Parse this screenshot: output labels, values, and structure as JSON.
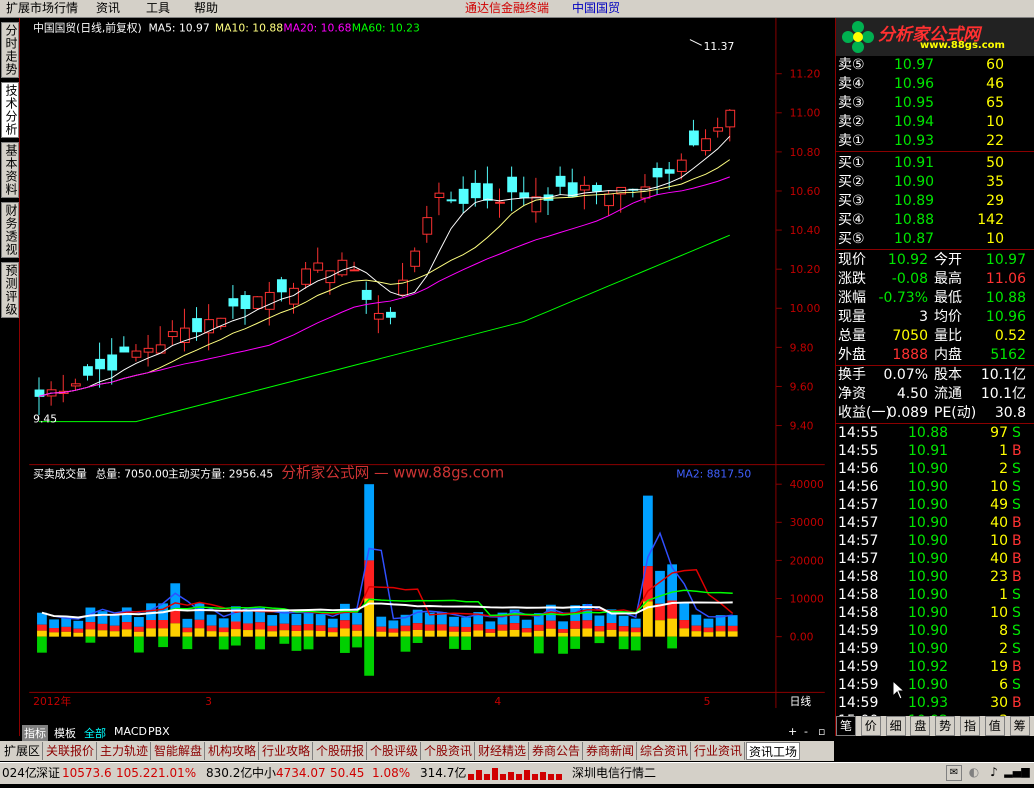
{
  "menubar": {
    "items": [
      "扩展市场行情",
      "资讯",
      "工具",
      "帮助"
    ],
    "brand": "通达信金融终端",
    "stock": "中国国贸"
  },
  "watermark": {
    "logo": "分析家公式网",
    "url": "www.88gs.com",
    "overlay": "分析家公式网 — www.88gs.com"
  },
  "left_tabs": [
    "分时走势",
    "技术分析",
    "基本资料",
    "财务透视",
    "预测评级"
  ],
  "kline": {
    "header": "中国国贸(日线,前复权)",
    "ma5": "MA5: 10.97",
    "ma10": "MA10: 10.88",
    "ma20": "MA20: 10.68",
    "ma60": "MA60: 10.23",
    "ticks": [
      "11.20",
      "11.00",
      "10.80",
      "10.60",
      "10.40",
      "10.20",
      "10.00",
      "9.80",
      "9.60",
      "9.40"
    ],
    "high_label": "11.37",
    "low_label": "9.45"
  },
  "volume": {
    "header": "买卖成交量",
    "total": "总量: 7050.00",
    "active_buy": "主动买方量: 2956.45",
    "ma2": "MA2: 8817.50",
    "ticks": [
      "40000",
      "30000",
      "20000",
      "10000",
      "0.00"
    ]
  },
  "x_axis": {
    "labels": [
      "2012年",
      "3",
      "4",
      "5"
    ],
    "period": "日线"
  },
  "indicator_tabs": [
    "指标",
    "模板",
    "全部",
    "MACD",
    "PBX"
  ],
  "bottom_tabs": [
    "扩展区",
    "关联报价",
    "主力轨迹",
    "智能解盘",
    "机构攻略",
    "行业攻略",
    "个股研报",
    "个股评级",
    "个股资讯",
    "财经精选",
    "券商公告",
    "券商新闻",
    "综合资讯",
    "行业资讯",
    "资讯工场"
  ],
  "right_tabs": [
    "笔",
    "价",
    "细",
    "盘",
    "势",
    "指",
    "值",
    "筹"
  ],
  "orderbook": {
    "sell": [
      {
        "label": "卖⑤",
        "price": "10.97",
        "vol": "60"
      },
      {
        "label": "卖④",
        "price": "10.96",
        "vol": "46"
      },
      {
        "label": "卖③",
        "price": "10.95",
        "vol": "65"
      },
      {
        "label": "卖②",
        "price": "10.94",
        "vol": "10"
      },
      {
        "label": "卖①",
        "price": "10.93",
        "vol": "22"
      }
    ],
    "buy": [
      {
        "label": "买①",
        "price": "10.91",
        "vol": "50"
      },
      {
        "label": "买②",
        "price": "10.90",
        "vol": "35"
      },
      {
        "label": "买③",
        "price": "10.89",
        "vol": "29"
      },
      {
        "label": "买④",
        "price": "10.88",
        "vol": "142"
      },
      {
        "label": "买⑤",
        "price": "10.87",
        "vol": "10"
      }
    ]
  },
  "quote": [
    {
      "l1": "现价",
      "v1": "10.92",
      "l2": "今开",
      "v2": "10.97",
      "c1": "green",
      "c2": "green"
    },
    {
      "l1": "涨跌",
      "v1": "-0.08",
      "l2": "最高",
      "v2": "11.06",
      "c1": "green",
      "c2": "red"
    },
    {
      "l1": "涨幅",
      "v1": "-0.73%",
      "l2": "最低",
      "v2": "10.88",
      "c1": "green",
      "c2": "green"
    },
    {
      "l1": "现量",
      "v1": "3",
      "l2": "均价",
      "v2": "10.96",
      "c1": "white",
      "c2": "green"
    },
    {
      "l1": "总量",
      "v1": "7050",
      "l2": "量比",
      "v2": "0.52",
      "c1": "yellow",
      "c2": "yellow"
    },
    {
      "l1": "外盘",
      "v1": "1888",
      "l2": "内盘",
      "v2": "5162",
      "c1": "red",
      "c2": "green"
    }
  ],
  "quote2": [
    {
      "l1": "换手",
      "v1": "0.07%",
      "l2": "股本",
      "v2": "10.1亿"
    },
    {
      "l1": "净资",
      "v1": "4.50",
      "l2": "流通",
      "v2": "10.1亿"
    },
    {
      "l1": "收益(一)",
      "v1": "0.089",
      "l2": "PE(动)",
      "v2": "30.8"
    }
  ],
  "ticks": [
    {
      "t": "14:55",
      "p": "10.88",
      "v": "97",
      "s": "S"
    },
    {
      "t": "14:55",
      "p": "10.91",
      "v": "1",
      "s": "B"
    },
    {
      "t": "14:56",
      "p": "10.90",
      "v": "2",
      "s": "S"
    },
    {
      "t": "14:56",
      "p": "10.90",
      "v": "10",
      "s": "S"
    },
    {
      "t": "14:57",
      "p": "10.90",
      "v": "49",
      "s": "S"
    },
    {
      "t": "14:57",
      "p": "10.90",
      "v": "40",
      "s": "B"
    },
    {
      "t": "14:57",
      "p": "10.90",
      "v": "10",
      "s": "B"
    },
    {
      "t": "14:57",
      "p": "10.90",
      "v": "40",
      "s": "B"
    },
    {
      "t": "14:58",
      "p": "10.90",
      "v": "23",
      "s": "B"
    },
    {
      "t": "14:58",
      "p": "10.90",
      "v": "1",
      "s": "S"
    },
    {
      "t": "14:58",
      "p": "10.90",
      "v": "10",
      "s": "S"
    },
    {
      "t": "14:59",
      "p": "10.90",
      "v": "8",
      "s": "S"
    },
    {
      "t": "14:59",
      "p": "10.90",
      "v": "2",
      "s": "S"
    },
    {
      "t": "14:59",
      "p": "10.92",
      "v": "19",
      "s": "B"
    },
    {
      "t": "14:59",
      "p": "10.90",
      "v": "6",
      "s": "S"
    },
    {
      "t": "14:59",
      "p": "10.93",
      "v": "30",
      "s": "B"
    },
    {
      "t": "15:00",
      "p": "10.92",
      "v": "3",
      "s": ""
    }
  ],
  "statusbar": {
    "seg0": "024亿",
    "sz_name": "深证",
    "sz_val": "10573.6",
    "sz_chg": "105.22",
    "sz_pct": "1.01%",
    "sz_amt": "830.2亿",
    "zx_name": "中小",
    "zx_val": "4734.07",
    "zx_chg": "50.45",
    "zx_pct": "1.08%",
    "zx_amt": "314.7亿",
    "server": "深圳电信行情二"
  },
  "colors": {
    "up": "#ff3232",
    "down": "#00ffff",
    "ma5": "#ffffff",
    "ma10": "#ffff80",
    "ma20": "#ff00ff",
    "ma60": "#00ff00",
    "frame": "#8b0000"
  }
}
